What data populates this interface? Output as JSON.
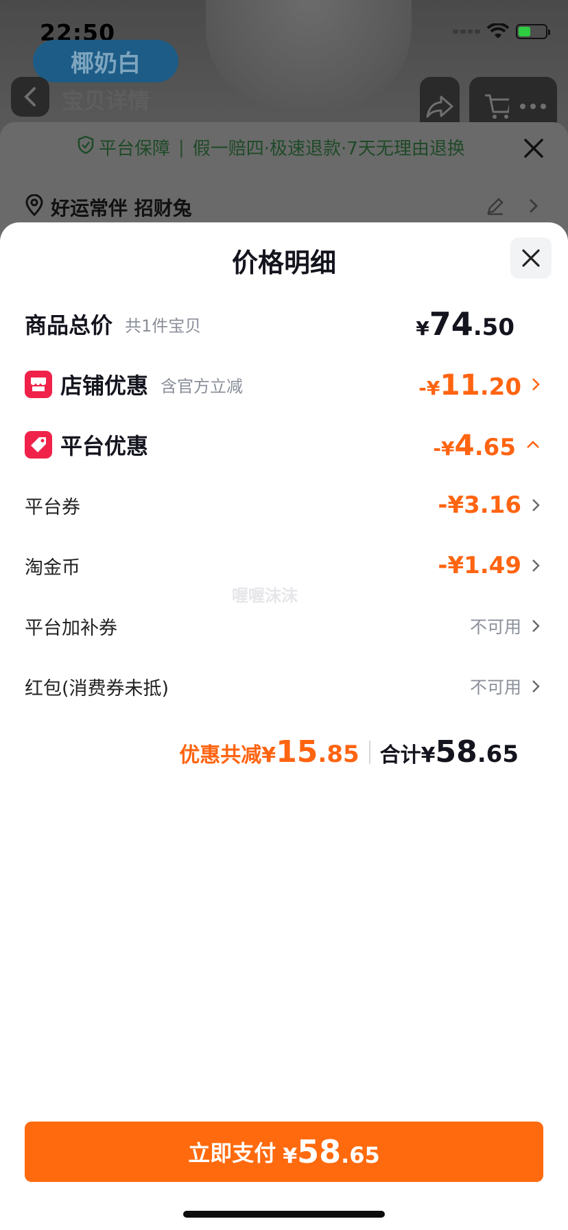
{
  "status_bar": {
    "time": "22:50"
  },
  "background": {
    "color_option": "椰奶白",
    "nav_title": "宝贝详情",
    "guarantee": {
      "title": "平台保障",
      "items": "假一赔四·极速退款·7天无理由退换"
    },
    "address": "好运常伴 招财兔"
  },
  "sheet": {
    "title": "价格明细",
    "watermark": "喔喔沫沫",
    "rows": {
      "goods_total": {
        "label": "商品总价",
        "sub": "共1件宝贝",
        "yen": "¥",
        "int": "74",
        "dec": ".50"
      },
      "shop_discount": {
        "label": "店铺优惠",
        "sub": "含官方立减",
        "prefix": "-¥",
        "int": "11",
        "dec": ".20"
      },
      "platform_discount": {
        "label": "平台优惠",
        "prefix": "-¥",
        "int": "4",
        "dec": ".65"
      },
      "platform_coupon": {
        "label": "平台券",
        "value": "-¥3.16"
      },
      "taojin_coin": {
        "label": "淘金币",
        "value": "-¥1.49"
      },
      "platform_extra_coupon": {
        "label": "平台加补券",
        "value": "不可用"
      },
      "red_packet": {
        "label": "红包(消费券未抵)",
        "value": "不可用"
      }
    },
    "summary": {
      "discount_label": "优惠共减¥",
      "discount_int": "15",
      "discount_dec": ".85",
      "total_label": "合计¥",
      "total_int": "58",
      "total_dec": ".65"
    },
    "pay_button": {
      "label": "立即支付",
      "yen": "¥",
      "int": "58",
      "dec": ".65"
    }
  },
  "colors": {
    "accent": "#ff6a0f",
    "discount": "#ff6411",
    "badge": "#f0224a"
  }
}
